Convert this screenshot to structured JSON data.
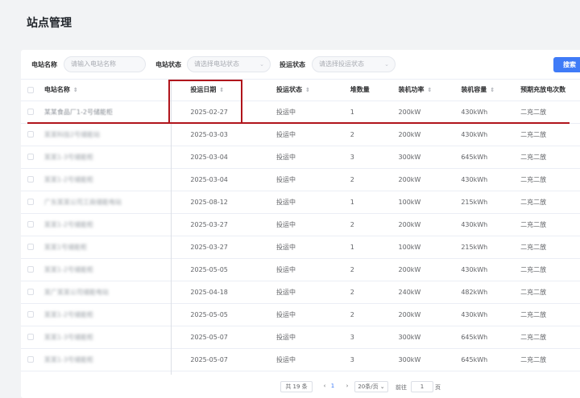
{
  "page": {
    "title": "站点管理"
  },
  "filters": {
    "station_name_label": "电站名称",
    "station_name_placeholder": "请输入电站名称",
    "station_status_label": "电站状态",
    "station_status_placeholder": "请选择电站状态",
    "operation_status_label": "投运状态",
    "operation_status_placeholder": "请选择投运状态",
    "search_button": "搜索",
    "chevron_icon": "chevron-down-icon"
  },
  "table": {
    "columns": [
      "电站名称",
      "投运日期",
      "投运状态",
      "堆数量",
      "装机功率",
      "装机容量",
      "预期充放电次数"
    ],
    "rows": [
      {
        "name": "某某食品厂1-2号储能柜",
        "date": "2025-02-27",
        "status": "投运中",
        "stacks": "1",
        "power": "200kW",
        "capacity": "430kWh",
        "cycles": "二充二放"
      },
      {
        "name": "某某科技2号储能站",
        "date": "2025-03-03",
        "status": "投运中",
        "stacks": "2",
        "power": "200kW",
        "capacity": "430kWh",
        "cycles": "二充二放"
      },
      {
        "name": "某某1-3号储能柜",
        "date": "2025-03-04",
        "status": "投运中",
        "stacks": "3",
        "power": "300kW",
        "capacity": "645kWh",
        "cycles": "二充二放"
      },
      {
        "name": "某某1-2号储能柜",
        "date": "2025-03-04",
        "status": "投运中",
        "stacks": "2",
        "power": "200kW",
        "capacity": "430kWh",
        "cycles": "二充二放"
      },
      {
        "name": "广东某某公司工商储能电站",
        "date": "2025-08-12",
        "status": "投运中",
        "stacks": "1",
        "power": "100kW",
        "capacity": "215kWh",
        "cycles": "二充二放"
      },
      {
        "name": "某某1-2号储能柜",
        "date": "2025-03-27",
        "status": "投运中",
        "stacks": "2",
        "power": "200kW",
        "capacity": "430kWh",
        "cycles": "二充二放"
      },
      {
        "name": "某某1号储能柜",
        "date": "2025-03-27",
        "status": "投运中",
        "stacks": "1",
        "power": "100kW",
        "capacity": "215kWh",
        "cycles": "二充二放"
      },
      {
        "name": "某某1-2号储能柜",
        "date": "2025-05-05",
        "status": "投运中",
        "stacks": "2",
        "power": "200kW",
        "capacity": "430kWh",
        "cycles": "二充二放"
      },
      {
        "name": "某广某某公司储能电站",
        "date": "2025-04-18",
        "status": "投运中",
        "stacks": "2",
        "power": "240kW",
        "capacity": "482kWh",
        "cycles": "二充二放"
      },
      {
        "name": "某某1-2号储能柜",
        "date": "2025-05-05",
        "status": "投运中",
        "stacks": "2",
        "power": "200kW",
        "capacity": "430kWh",
        "cycles": "二充二放"
      },
      {
        "name": "某某1-3号储能柜",
        "date": "2025-05-07",
        "status": "投运中",
        "stacks": "3",
        "power": "300kW",
        "capacity": "645kWh",
        "cycles": "二充二放"
      },
      {
        "name": "某某1-3号储能柜",
        "date": "2025-05-07",
        "status": "投运中",
        "stacks": "3",
        "power": "300kW",
        "capacity": "645kWh",
        "cycles": "二充二放"
      }
    ]
  },
  "pagination": {
    "total": "共 19 条",
    "prev": "‹",
    "current_page": "1",
    "next": "›",
    "page_size": "20条/页",
    "goto_label": "前往",
    "goto_value": "1",
    "page_suffix": "页"
  },
  "annotation": {
    "color": "#b0141b"
  }
}
